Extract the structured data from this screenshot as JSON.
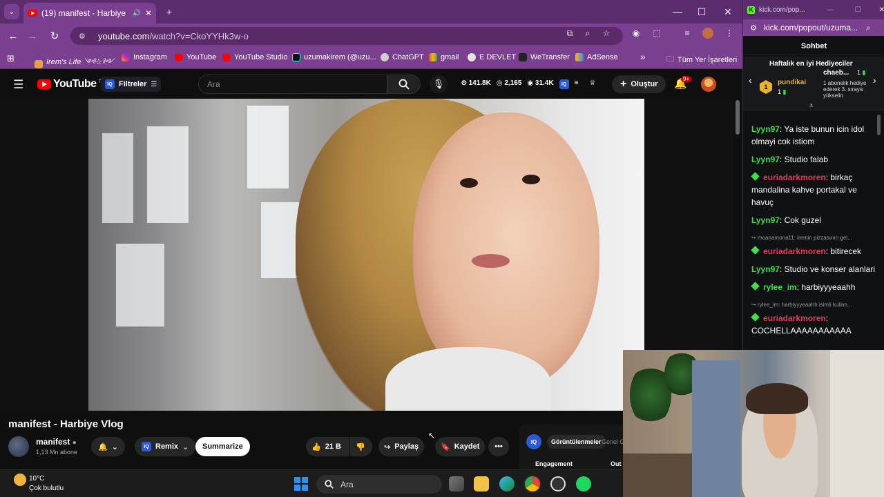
{
  "browser": {
    "tab_title": "(19) manifest - Harbiye Vlog",
    "url_host": "youtube.com",
    "url_path": "/watch?v=CkoYYHk3w-o",
    "bookmarks": [
      "Irem's Life ༺☆༻",
      "Instagram",
      "YouTube",
      "YouTube Studio",
      "uzumakirem (@uzu...",
      "ChatGPT",
      "gmail",
      "E DEVLET",
      "WeTransfer",
      "AdSense"
    ],
    "bookmarks_more": "»",
    "all_bookmarks": "Tüm Yer İşaretleri"
  },
  "youtube": {
    "logo": "YouTube",
    "region": "TR",
    "filters_label": "Filtreler",
    "search_placeholder": "Ara",
    "stats": [
      "141.8K",
      "2,165",
      "31.4K"
    ],
    "create_label": "Oluştur",
    "notif_badge": "9+",
    "video_title": "manifest - Harbiye Vlog",
    "channel_name": "manifest",
    "subscribers": "1,13 Mn abone",
    "remix_label": "Remix",
    "summarize_label": "Summarize",
    "likes": "21 B",
    "share_label": "Paylaş",
    "save_label": "Kaydet",
    "side_tab": "Görüntülenmeler",
    "side_tab2": "Genel G",
    "engagement_label": "Engagement",
    "out_label": "Out"
  },
  "kick": {
    "title_short": "kick.com/pop...",
    "url": "kick.com/popout/uzuma...",
    "header": "Sohbet",
    "gifters_title": "Haftalık en iyi Hediyeciler",
    "top_gifter": "pundikai",
    "top_gifter_count": "1",
    "second_gifter": "chaeb...",
    "second_gifter_count": "1",
    "gift_note": "1 abonelik hediye ederek 3. sıraya yükselin",
    "messages": [
      {
        "user": "Lyyn97",
        "color": "#3ee04a",
        "text": "Ya iste bunun icin idol olmayi cok istiom",
        "reply": "",
        "gem": false
      },
      {
        "user": "Lyyn97",
        "color": "#3ee04a",
        "text": "Studio falab",
        "reply": "",
        "gem": false
      },
      {
        "user": "euriadarkmoren",
        "color": "#e03a5c",
        "text": "birkaç mandalina kahve portakal ve havuç",
        "reply": "",
        "gem": true
      },
      {
        "user": "Lyyn97",
        "color": "#3ee04a",
        "text": "Cok guzel",
        "reply": "",
        "gem": false
      },
      {
        "user": "euriadarkmoren",
        "color": "#e03a5c",
        "text": "bitirecek",
        "reply": "moanamona11: iremin pizzasının gel...",
        "gem": true
      },
      {
        "user": "Lyyn97",
        "color": "#3ee04a",
        "text": "Studio ve konser alanlari",
        "reply": "",
        "gem": false
      },
      {
        "user": "rylee_im",
        "color": "#3ee04a",
        "text": "harbiyyyeaahh",
        "reply": "",
        "gem": true
      },
      {
        "user": "euriadarkmoren",
        "color": "#e03a5c",
        "text": "COCHELLAAAAAAAAAAA",
        "reply": "rylee_im: harbiyyyeaahh isimli kullan...",
        "gem": true
      }
    ]
  },
  "taskbar": {
    "temp": "10°C",
    "weather": "Çok bulutlu",
    "search_placeholder": "Ara"
  }
}
